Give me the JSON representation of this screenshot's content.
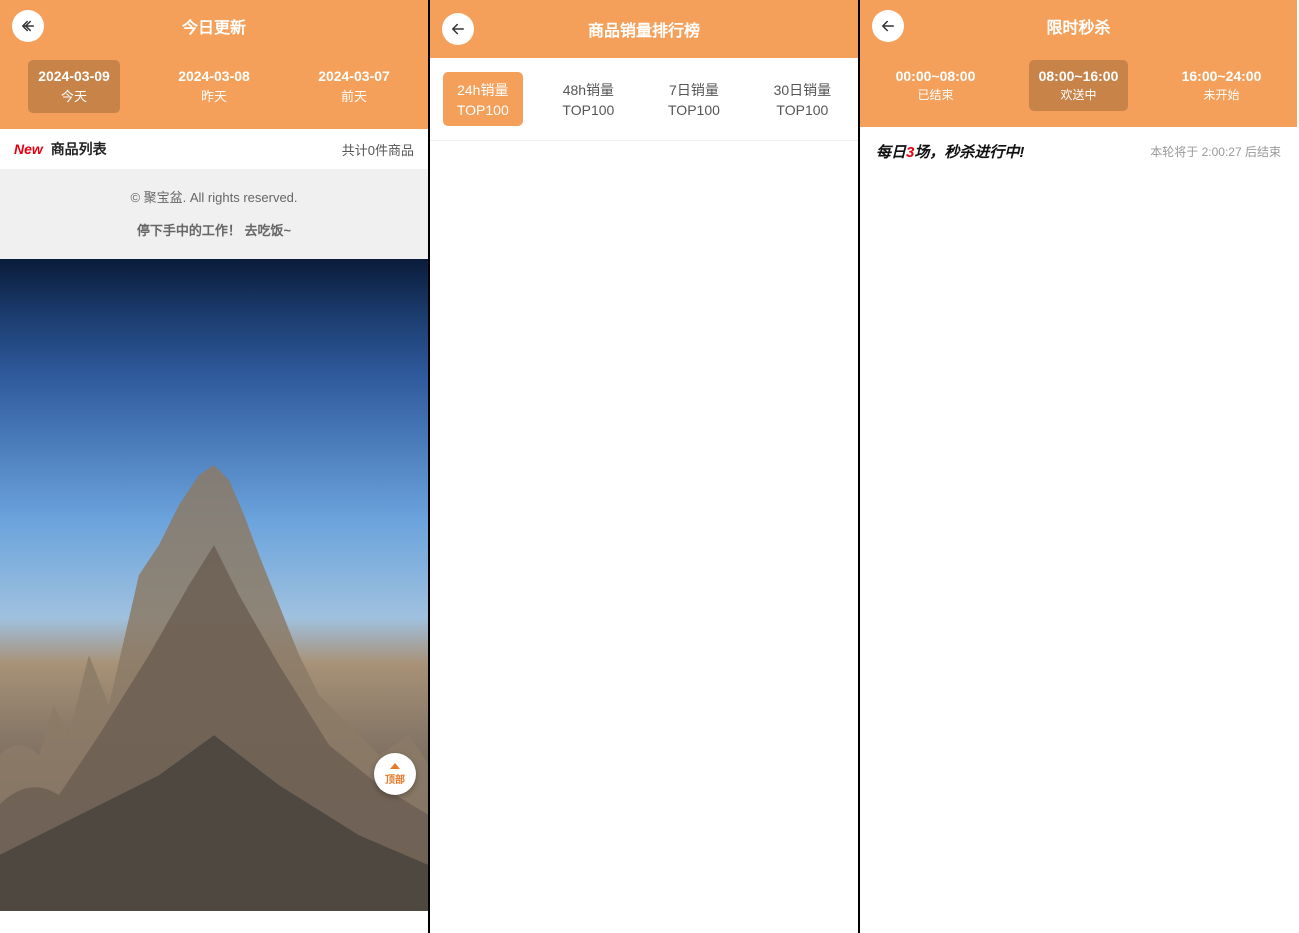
{
  "panel1": {
    "header_title": "今日更新",
    "tabs": [
      {
        "line1": "2024-03-09",
        "line2": "今天"
      },
      {
        "line1": "2024-03-08",
        "line2": "昨天"
      },
      {
        "line1": "2024-03-07",
        "line2": "前天"
      }
    ],
    "new_badge": "New",
    "list_title": "商品列表",
    "count_text": "共计0件商品",
    "footer_line1": "© 聚宝盆. All rights reserved.",
    "footer_line2": "停下手中的工作！ 去吃饭~",
    "fab_label": "顶部"
  },
  "panel2": {
    "header_title": "商品销量排行榜",
    "tabs": [
      {
        "line1": "24h销量",
        "line2": "TOP100"
      },
      {
        "line1": "48h销量",
        "line2": "TOP100"
      },
      {
        "line1": "7日销量",
        "line2": "TOP100"
      },
      {
        "line1": "30日销量",
        "line2": "TOP100"
      }
    ]
  },
  "panel3": {
    "header_title": "限时秒杀",
    "tabs": [
      {
        "line1": "00:00~08:00",
        "line2": "已结束"
      },
      {
        "line1": "08:00~16:00",
        "line2": "欢送中"
      },
      {
        "line1": "16:00~24:00",
        "line2": "未开始"
      }
    ],
    "slogan_prefix": "每日",
    "slogan_red": "3",
    "slogan_suffix": "场，秒杀进行中!",
    "timer_prefix": "本轮将于 ",
    "timer_value": "2:00:27",
    "timer_suffix": " 后结束"
  },
  "colors": {
    "accent": "#f5a05a",
    "tab_active_bg": "rgba(0,0,0,0.18)",
    "red": "#e60012"
  }
}
